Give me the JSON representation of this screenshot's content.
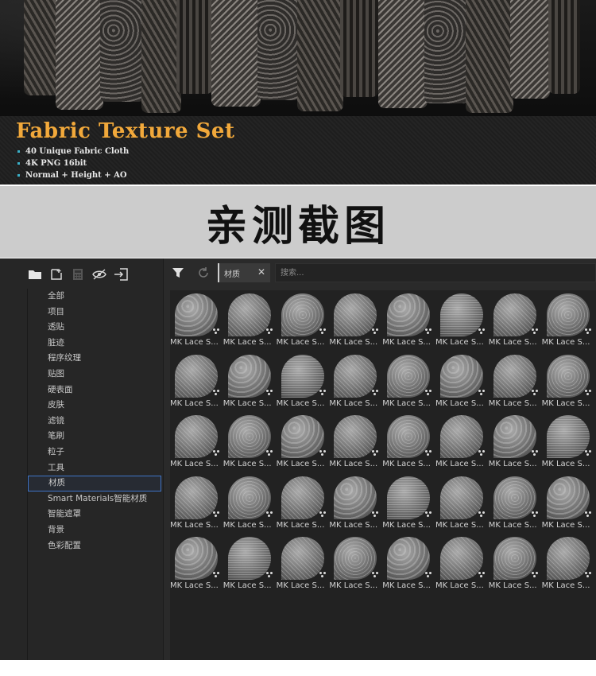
{
  "banner": {
    "title": "Fabric Texture Set",
    "features": [
      "40 Unique Fabric Cloth",
      "4K PNG 16bit",
      "Normal + Height + AO"
    ],
    "title_color": "#f2a93b",
    "bullet_color": "#3ab0c8"
  },
  "caption": {
    "text": "亲测截图"
  },
  "toolbar": {
    "icons": [
      "folder-icon",
      "new-document-icon",
      "calculator-icon",
      "hide-icon",
      "import-icon"
    ]
  },
  "categories": [
    {
      "label": "全部"
    },
    {
      "label": "项目"
    },
    {
      "label": "透贴"
    },
    {
      "label": "脏迹"
    },
    {
      "label": "程序纹理"
    },
    {
      "label": "贴图"
    },
    {
      "label": "硬表面"
    },
    {
      "label": "皮肤"
    },
    {
      "label": "滤镜"
    },
    {
      "label": "笔刷"
    },
    {
      "label": "粒子"
    },
    {
      "label": "工具"
    },
    {
      "label": "材质",
      "selected": true
    },
    {
      "label": "Smart Materials智能材质"
    },
    {
      "label": "智能遮罩"
    },
    {
      "label": "背景"
    },
    {
      "label": "色彩配置"
    }
  ],
  "filter": {
    "chip_label": "材质",
    "chip_close": "✕",
    "search_placeholder": "搜索..."
  },
  "assets": {
    "columns": 8,
    "rows": 5,
    "item_label": "MK Lace S..."
  },
  "colors": {
    "selection_border": "#3f74c7",
    "panel": "#2b2b2b",
    "grid_bg": "#222222"
  }
}
